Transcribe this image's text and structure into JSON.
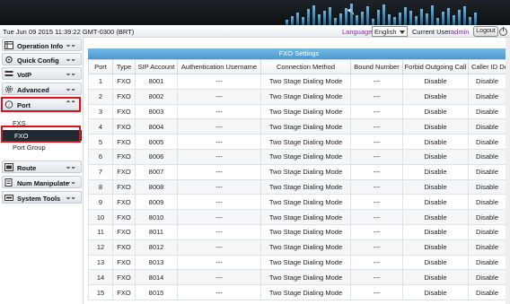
{
  "status": {
    "datetime": "Tue Jun 09 2015 11:39:22 GMT-0300 (BRT)",
    "language_label": "Language",
    "language_value": "English",
    "user_label": "Current User:",
    "user_name": "admin",
    "logout_label": "Logout"
  },
  "sidebar": {
    "items": [
      {
        "label": "Operation Info",
        "icon": "info-grid-icon"
      },
      {
        "label": "Quick Config",
        "icon": "gear-hand-icon"
      },
      {
        "label": "VoIP",
        "icon": "voip-icon"
      },
      {
        "label": "Advanced",
        "icon": "cog-icon"
      },
      {
        "label": "Port",
        "icon": "port-info-icon"
      },
      {
        "label": "Route",
        "icon": "route-icon"
      },
      {
        "label": "Num Manipulate",
        "icon": "num-icon"
      },
      {
        "label": "System Tools",
        "icon": "tools-icon"
      }
    ],
    "port_sub": [
      "FXS",
      "FXO",
      "Port Group"
    ]
  },
  "main": {
    "title": "FXO Settings",
    "columns": [
      "Port",
      "Type",
      "SIP Account",
      "Authentication Username",
      "Connection Method",
      "Bound Number",
      "Forbid Outgoing Call",
      "Caller ID Det"
    ],
    "rows": [
      [
        "1",
        "FXO",
        "8001",
        "---",
        "Two Stage Dialing Mode",
        "---",
        "Disable",
        "Disable"
      ],
      [
        "2",
        "FXO",
        "8002",
        "---",
        "Two Stage Dialing Mode",
        "---",
        "Disable",
        "Disable"
      ],
      [
        "3",
        "FXO",
        "8003",
        "---",
        "Two Stage Dialing Mode",
        "---",
        "Disable",
        "Disable"
      ],
      [
        "4",
        "FXO",
        "8004",
        "---",
        "Two Stage Dialing Mode",
        "---",
        "Disable",
        "Disable"
      ],
      [
        "5",
        "FXO",
        "8005",
        "---",
        "Two Stage Dialing Mode",
        "---",
        "Disable",
        "Disable"
      ],
      [
        "6",
        "FXO",
        "8006",
        "---",
        "Two Stage Dialing Mode",
        "---",
        "Disable",
        "Disable"
      ],
      [
        "7",
        "FXO",
        "8007",
        "---",
        "Two Stage Dialing Mode",
        "---",
        "Disable",
        "Disable"
      ],
      [
        "8",
        "FXO",
        "8008",
        "---",
        "Two Stage Dialing Mode",
        "---",
        "Disable",
        "Disable"
      ],
      [
        "9",
        "FXO",
        "8009",
        "---",
        "Two Stage Dialing Mode",
        "---",
        "Disable",
        "Disable"
      ],
      [
        "10",
        "FXO",
        "8010",
        "---",
        "Two Stage Dialing Mode",
        "---",
        "Disable",
        "Disable"
      ],
      [
        "11",
        "FXO",
        "8011",
        "---",
        "Two Stage Dialing Mode",
        "---",
        "Disable",
        "Disable"
      ],
      [
        "12",
        "FXO",
        "8012",
        "---",
        "Two Stage Dialing Mode",
        "---",
        "Disable",
        "Disable"
      ],
      [
        "13",
        "FXO",
        "8013",
        "---",
        "Two Stage Dialing Mode",
        "---",
        "Disable",
        "Disable"
      ],
      [
        "14",
        "FXO",
        "8014",
        "---",
        "Two Stage Dialing Mode",
        "---",
        "Disable",
        "Disable"
      ],
      [
        "15",
        "FXO",
        "8015",
        "---",
        "Two Stage Dialing Mode",
        "---",
        "Disable",
        "Disable"
      ]
    ]
  },
  "colors": {
    "accent": "#4b98cf",
    "highlight": "#e0101a",
    "user": "#8a2aa6"
  }
}
